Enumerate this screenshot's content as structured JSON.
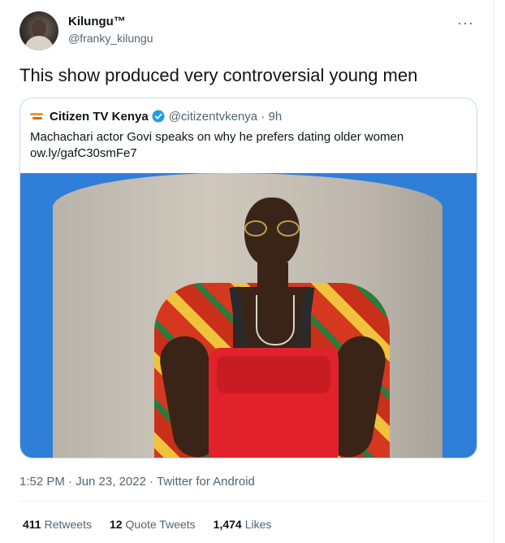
{
  "author": {
    "display_name": "Kilungu™",
    "handle": "@franky_kilungu",
    "more_icon": "more-horizontal-icon"
  },
  "tweet": {
    "text": "This show produced very controversial young men",
    "timestamp": "1:52 PM · Jun 23, 2022 · Twitter for Android"
  },
  "quoted_tweet": {
    "display_name": "Citizen TV Kenya",
    "verified_icon": "verified-badge-icon",
    "handle_time": "@citizentvkenya · 9h",
    "text": "Machachari actor Govi speaks on why he prefers dating older women",
    "link": "ow.ly/gafC30smFe7",
    "image": "photo of young man in sunglasses and floral shirt with red chest bag in front of a rock"
  },
  "stats": {
    "retweets_count": "411",
    "retweets_label": "Retweets",
    "quotes_count": "12",
    "quotes_label": "Quote Tweets",
    "likes_count": "1,474",
    "likes_label": "Likes"
  },
  "colors": {
    "text_primary": "#0f1419",
    "text_secondary": "#536471",
    "verified": "#1d9bf0",
    "border": "#cfd9de"
  }
}
